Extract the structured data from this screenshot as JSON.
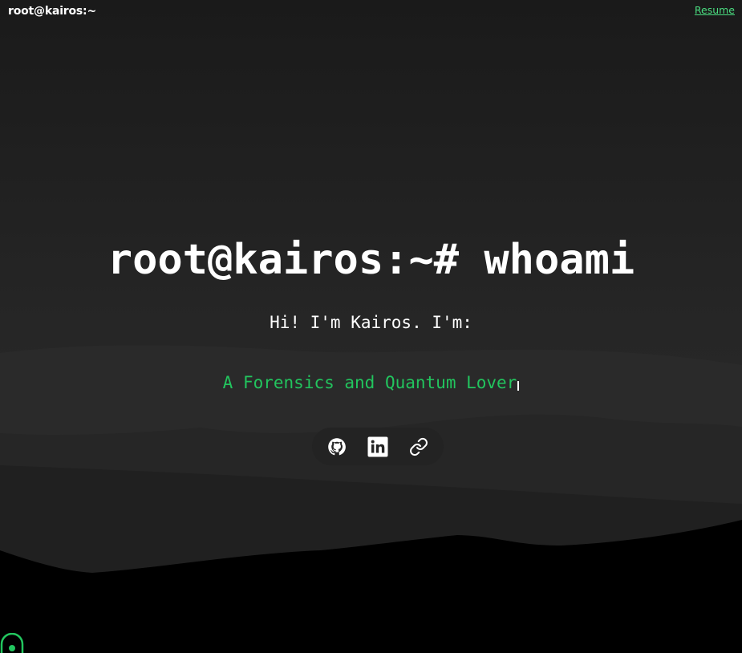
{
  "header": {
    "brand": "root@kairos:~",
    "resume_label": "Resume"
  },
  "hero": {
    "command": "root@kairos:~# whoami",
    "intro": "Hi! I'm Kairos. I'm:",
    "typed_text": "A Forensics and Quantum Lover"
  },
  "socials": {
    "icons": [
      "github-icon",
      "linkedin-icon",
      "link-icon"
    ]
  },
  "colors": {
    "accent": "#22c55e",
    "link": "#4ade80",
    "background": "#1c1c1c",
    "foreground": "#ffffff"
  }
}
